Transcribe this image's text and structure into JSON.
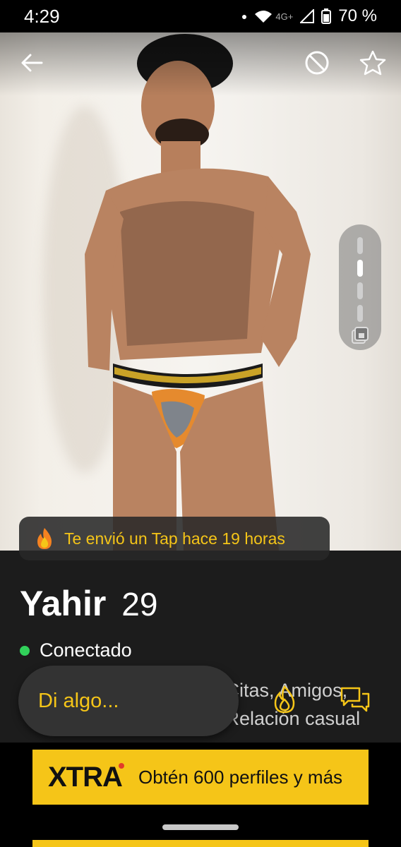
{
  "status_bar": {
    "time": "4:29",
    "network": "4G+",
    "battery": "70 %"
  },
  "profile": {
    "name": "Yahir",
    "age": "29",
    "online_status": "Conectado",
    "looking_for": "Citas, Amigos, Relación casual",
    "tap_message": "Te envió un Tap hace 19 horas"
  },
  "chat": {
    "placeholder": "Di algo..."
  },
  "banner": {
    "brand": "XTRA",
    "offer": "Obtén 600 perfiles y más"
  },
  "photo": {
    "count": 5,
    "current": 2
  },
  "colors": {
    "accent": "#f5c518",
    "online": "#31d15a",
    "background": "#1c1c1c"
  }
}
